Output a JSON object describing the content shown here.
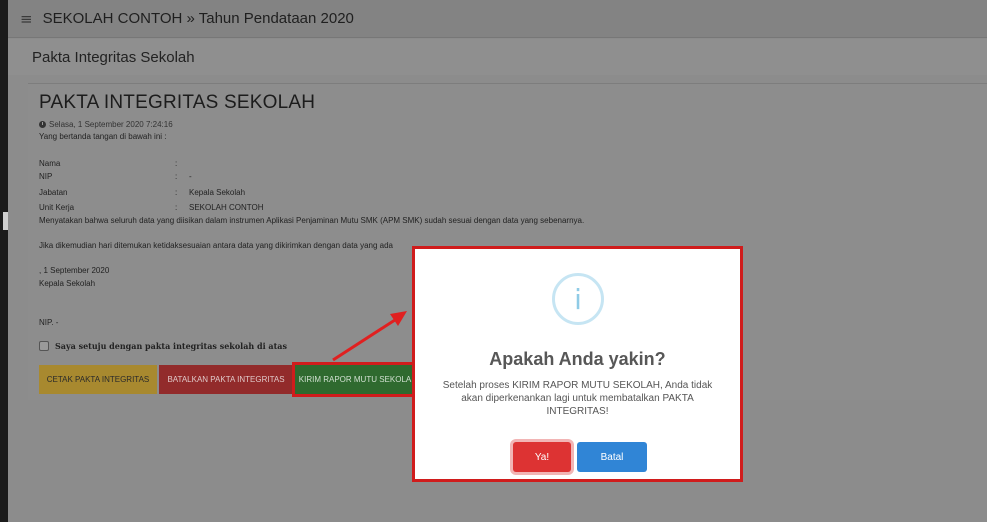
{
  "topbar": {
    "menu_glyph": "≡",
    "title": "SEKOLAH CONTOH » Tahun Pendataan 2020"
  },
  "subheader": {
    "title": "Pakta Integritas Sekolah"
  },
  "document": {
    "title": "PAKTA INTEGRITAS SEKOLAH",
    "datetime": "Selasa, 1 September 2020 7:24:16",
    "intro": "Yang bertanda tangan di bawah ini :",
    "fields": [
      {
        "label": "Nama",
        "sep": ":",
        "value": ""
      },
      {
        "label": "NIP",
        "sep": ":",
        "value": "-"
      },
      {
        "label": "Jabatan",
        "sep": ":",
        "value": "Kepala Sekolah"
      },
      {
        "label": "Unit Kerja",
        "sep": ":",
        "value": "SEKOLAH CONTOH"
      }
    ],
    "statement": "Menyatakan bahwa seluruh data yang diisikan dalam instrumen Aplikasi Penjaminan Mutu SMK (APM SMK) sudah sesuai dengan data yang sebenarnya.",
    "statement2": "Jika dikemudian hari ditemukan ketidaksesuaian antara data yang dikirimkan dengan data yang ada",
    "date_line": ", 1 September 2020",
    "signer_role": "Kepala Sekolah",
    "nip_line": "NIP. -",
    "agree_label": "Saya setuju dengan pakta integritas sekolah di atas"
  },
  "buttons": {
    "print": "CETAK PAKTA INTEGRITAS",
    "cancel": "BATALKAN PAKTA INTEGRITAS",
    "send": "KIRIM RAPOR MUTU SEKOLA"
  },
  "modal": {
    "icon": "i",
    "title": "Apakah Anda yakin?",
    "text": "Setelah proses KIRIM RAPOR MUTU SEKOLAH, Anda tidak akan diperkenankan lagi untuk membatalkan PAKTA INTEGRITAS!",
    "yes": "Ya!",
    "no": "Batal"
  },
  "colors": {
    "highlight": "#d01c1c",
    "confirm": "#dd3333",
    "cancel": "#3085d6",
    "info": "#8fcbe6"
  }
}
